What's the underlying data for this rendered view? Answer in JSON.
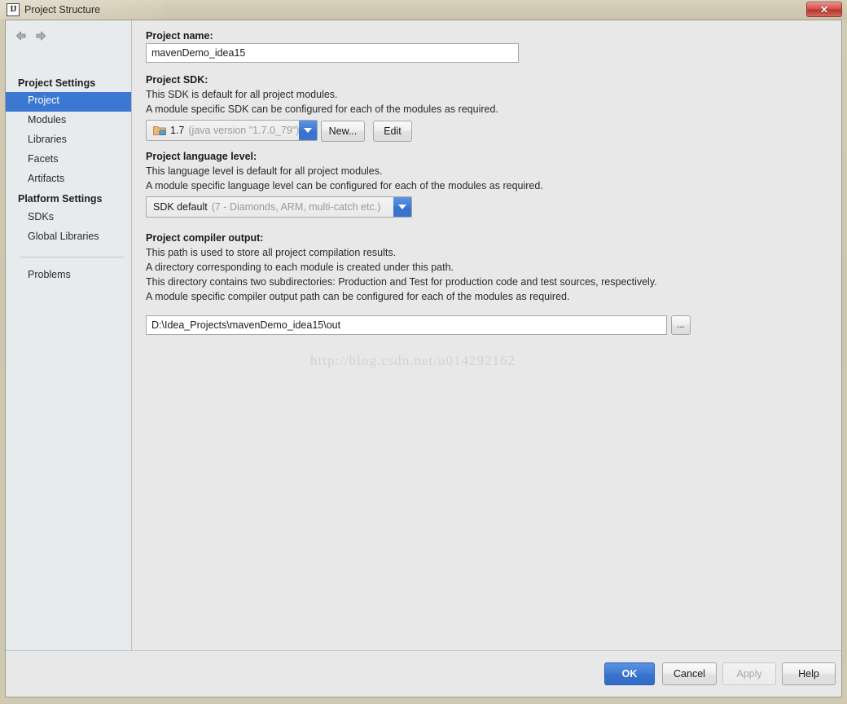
{
  "window": {
    "title": "Project Structure",
    "app_icon": "IJ",
    "close_label": "✕"
  },
  "sidebar": {
    "nav": {
      "back": "back-arrow",
      "forward": "forward-arrow"
    },
    "groups": [
      {
        "header": "Project Settings",
        "items": [
          "Project",
          "Modules",
          "Libraries",
          "Facets",
          "Artifacts"
        ]
      },
      {
        "header": "Platform Settings",
        "items": [
          "SDKs",
          "Global Libraries"
        ]
      }
    ],
    "selected": "Project",
    "extra_items": [
      "Problems"
    ]
  },
  "main": {
    "project_name": {
      "label": "Project name:",
      "value": "mavenDemo_idea15"
    },
    "project_sdk": {
      "label": "Project SDK:",
      "desc1": "This SDK is default for all project modules.",
      "desc2": "A module specific SDK can be configured for each of the modules as required.",
      "value": "1.7",
      "value_detail": "(java version \"1.7.0_79\")",
      "new_button": "New...",
      "edit_button": "Edit"
    },
    "language_level": {
      "label": "Project language level:",
      "desc1": "This language level is default for all project modules.",
      "desc2": "A module specific language level can be configured for each of the modules as required.",
      "value": "SDK default",
      "value_detail": "(7 - Diamonds, ARM, multi-catch etc.)"
    },
    "compiler_output": {
      "label": "Project compiler output:",
      "desc1": "This path is used to store all project compilation results.",
      "desc2": "A directory corresponding to each module is created under this path.",
      "desc3": "This directory contains two subdirectories: Production and Test for production code and test sources, respectively.",
      "desc4": "A module specific compiler output path can be configured for each of the modules as required.",
      "value": "D:\\Idea_Projects\\mavenDemo_idea15\\out",
      "browse_button": "..."
    },
    "watermark": "http://blog.csdn.net/u014292162"
  },
  "footer": {
    "ok": "OK",
    "cancel": "Cancel",
    "apply": "Apply",
    "help": "Help"
  },
  "colors": {
    "accent": "#3c77d1",
    "titlebar": "#cfc9b1",
    "sidebar": "#e7ebee",
    "panel": "#e8e8e8"
  }
}
